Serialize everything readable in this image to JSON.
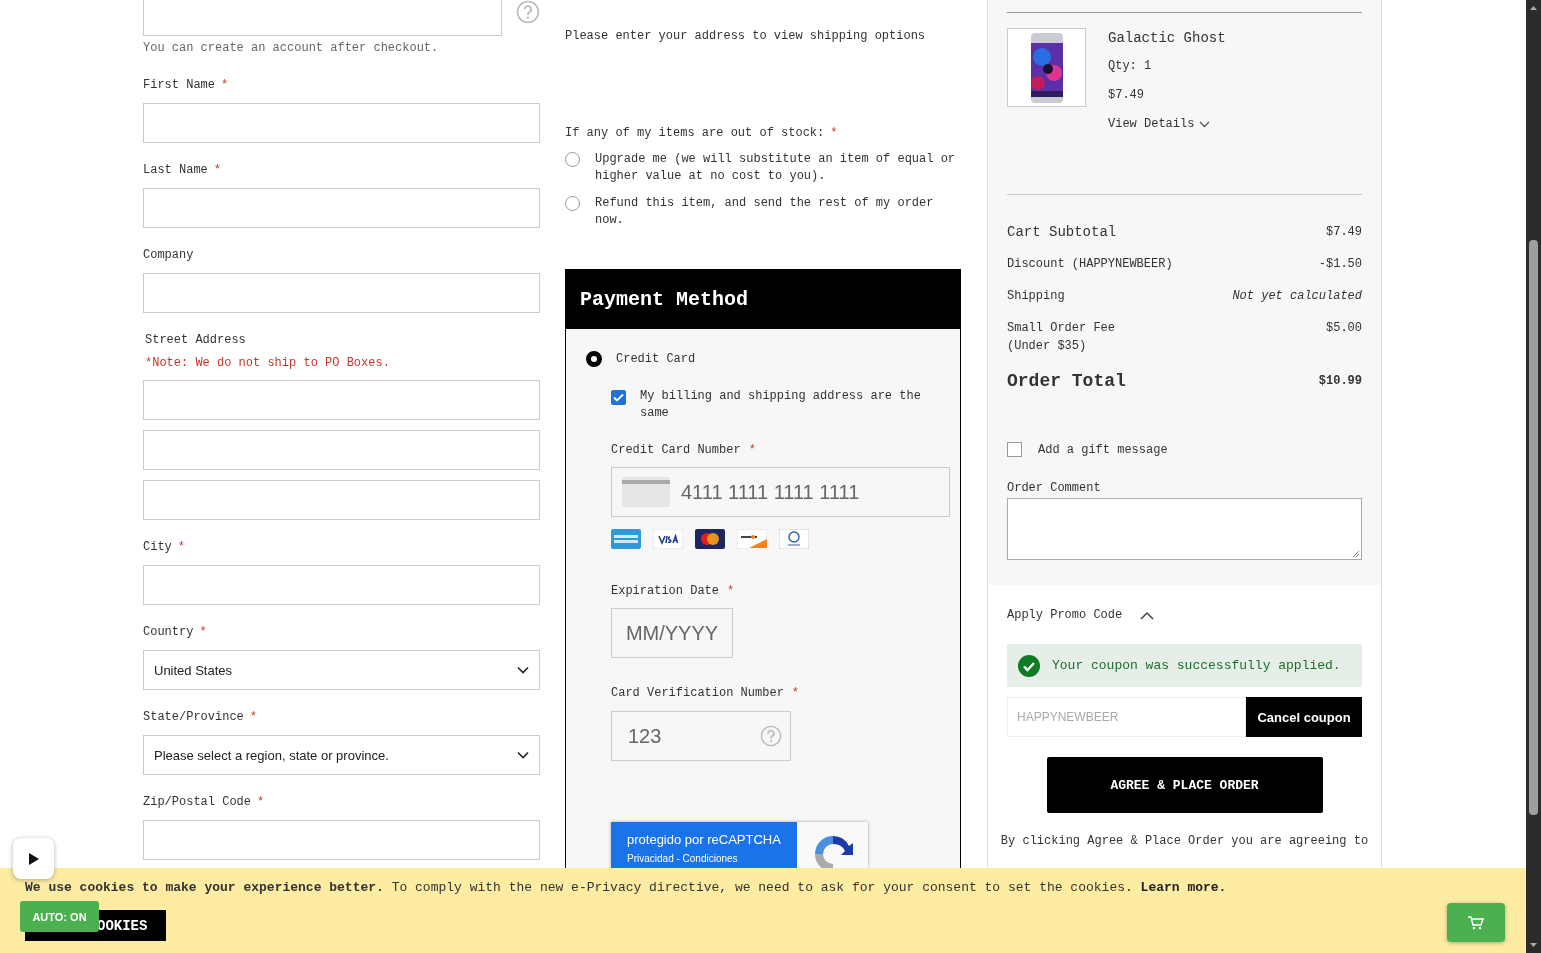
{
  "account": {
    "hint": "You can create an account after checkout."
  },
  "address_fields": [
    {
      "kind": "text",
      "label": "First Name",
      "mark": "*"
    },
    {
      "kind": "text",
      "label": "Last Name",
      "mark": "*"
    },
    {
      "kind": "text",
      "label": "Company"
    },
    {
      "kind": "street",
      "label": "Street Address",
      "note": "*Note: We do not ship to PO Boxes."
    },
    {
      "kind": "text",
      "label": "City",
      "mark": "*"
    },
    {
      "kind": "select",
      "label": "Country",
      "mark": "*",
      "value": "United States"
    },
    {
      "kind": "select",
      "label": "State/Province",
      "mark": "*",
      "value": "Please select a region, state or province."
    },
    {
      "kind": "text",
      "label": "Zip/Postal Code",
      "mark": "*"
    }
  ],
  "shipping": {
    "message": "Please enter your address to view shipping options"
  },
  "out_of_stock": {
    "question": "If any of my items are out of stock:",
    "mark": "*",
    "options": [
      {
        "label": "Upgrade me (we will substitute an item of equal or higher value at no cost to you).",
        "selected": false
      },
      {
        "label": "Refund this item, and send the rest of my order now.",
        "selected": false
      }
    ]
  },
  "payment": {
    "title": "Payment Method",
    "methods": [
      {
        "label": "Credit Card",
        "selected": true
      }
    ],
    "same_address": {
      "label": "My billing and shipping address are the same",
      "checked": true
    },
    "card_number": {
      "label": "Credit Card Number",
      "mark": "*",
      "placeholder": "4111 1111 1111 1111"
    },
    "expiration": {
      "label": "Expiration Date",
      "mark": "*",
      "placeholder": "MM/YYYY"
    },
    "cvv": {
      "label": "Card Verification Number",
      "mark": "*",
      "placeholder": "123"
    },
    "recaptcha": {
      "title": "protegido por reCAPTCHA",
      "links": "Privacidad - Condiciones"
    }
  },
  "cart_item": {
    "name": "Galactic Ghost",
    "qty": "Qty: 1",
    "price": "$7.49",
    "details": "View Details"
  },
  "totals": [
    {
      "kind": "subtotal",
      "label": "Cart Subtotal",
      "value": "$7.49"
    },
    {
      "kind": "line",
      "label": "Discount (HAPPYNEWBEER)",
      "value": "-$1.50"
    },
    {
      "kind": "pending",
      "label": "Shipping",
      "value": "Not yet calculated"
    },
    {
      "kind": "line",
      "label": "Small Order Fee",
      "note": "(Under $35)",
      "value": "$5.00"
    },
    {
      "kind": "total",
      "label": "Order Total",
      "value": "$10.99"
    }
  ],
  "gift_message": {
    "label": "Add a gift message",
    "checked": false
  },
  "order_comment": {
    "label": "Order Comment"
  },
  "promo": {
    "title": "Apply Promo Code",
    "expanded": true,
    "success": "Your coupon was successfully applied.",
    "code": "HAPPYNEWBEER",
    "disabled": true,
    "cancel": "Cancel coupon"
  },
  "place_order": "AGREE & PLACE ORDER",
  "terms": "By clicking Agree & Place Order you are agreeing to",
  "cookie_banner": {
    "text": "**We use cookies to make your experience better.** To comply with the new e-Privacy directive, we need to ask for your consent to set the cookies.",
    "link": "Learn more.",
    "button": "OOKIES"
  },
  "auto_badge": "AUTO: ON"
}
